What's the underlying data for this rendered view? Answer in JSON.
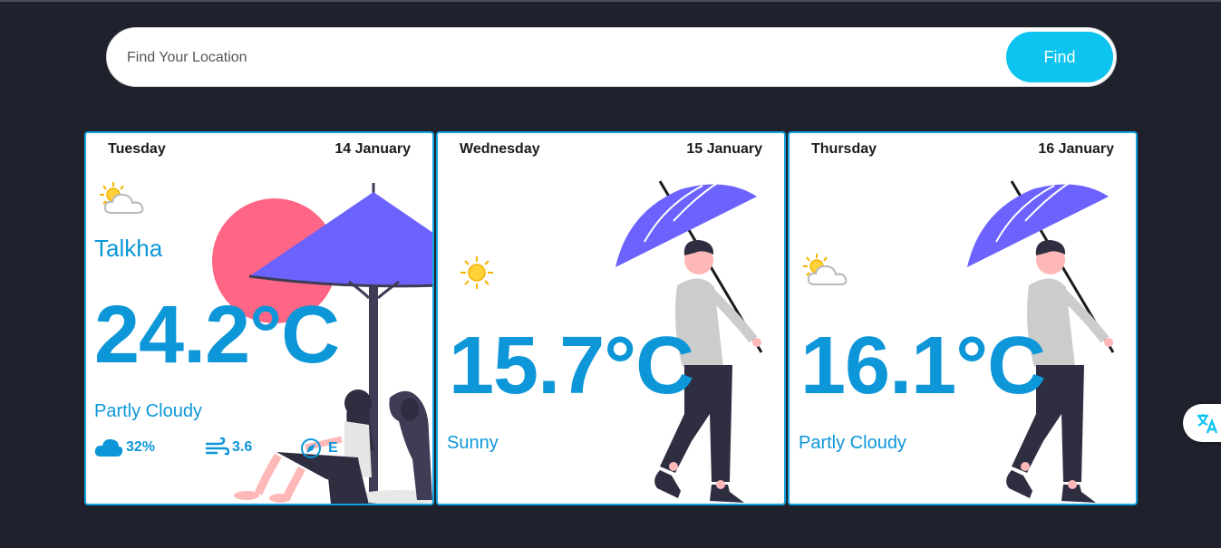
{
  "search": {
    "placeholder": "Find Your Location",
    "button_label": "Find"
  },
  "cards": [
    {
      "day": "Tuesday",
      "date": "14 January",
      "city": "Talkha",
      "temperature": "24.2°C",
      "condition": "Partly Cloudy",
      "icon": "partly-cloudy-icon",
      "humidity": "32%",
      "wind_speed": "3.6",
      "wind_direction": "E"
    },
    {
      "day": "Wednesday",
      "date": "15 January",
      "temperature": "15.7°C",
      "condition": "Sunny",
      "icon": "sunny-icon"
    },
    {
      "day": "Thursday",
      "date": "16 January",
      "temperature": "16.1°C",
      "condition": "Partly Cloudy",
      "icon": "partly-cloudy-icon"
    }
  ],
  "colors": {
    "background": "#1f212d",
    "accent": "#0d96d8",
    "button": "#0dc3ef",
    "umbrella": "#6c63ff",
    "sun": "#ff6584"
  }
}
